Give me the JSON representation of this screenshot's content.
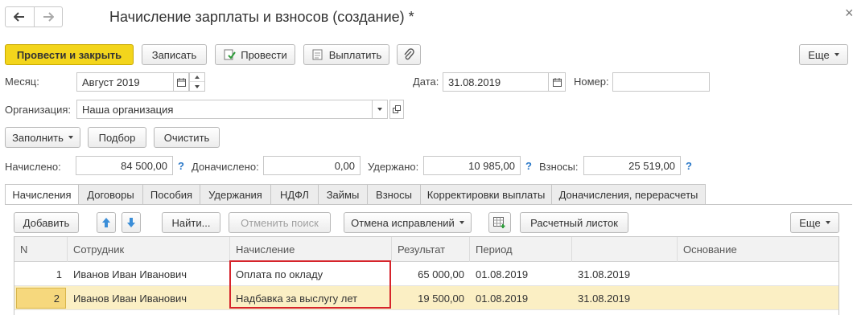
{
  "window": {
    "title": "Начисление зарплаты и взносов (создание) *",
    "close_glyph": "×"
  },
  "toolbar": {
    "post_and_close": "Провести и закрыть",
    "save": "Записать",
    "post": "Провести",
    "pay": "Выплатить",
    "more": "Еще"
  },
  "header": {
    "month_label": "Месяц:",
    "month_value": "Август 2019",
    "date_label": "Дата:",
    "date_value": "31.08.2019",
    "number_label": "Номер:",
    "number_value": "",
    "org_label": "Организация:",
    "org_value": "Наша организация"
  },
  "actions": {
    "fill": "Заполнить",
    "select": "Подбор",
    "clear": "Очистить"
  },
  "totals": {
    "accrued_label": "Начислено:",
    "accrued_value": "84 500,00",
    "additional_label": "Доначислено:",
    "additional_value": "0,00",
    "withheld_label": "Удержано:",
    "withheld_value": "10 985,00",
    "contributions_label": "Взносы:",
    "contributions_value": "25 519,00",
    "help_glyph": "?"
  },
  "tabs": [
    {
      "label": "Начисления",
      "active": true
    },
    {
      "label": "Договоры"
    },
    {
      "label": "Пособия"
    },
    {
      "label": "Удержания"
    },
    {
      "label": "НДФЛ"
    },
    {
      "label": "Займы"
    },
    {
      "label": "Взносы"
    },
    {
      "label": "Корректировки выплаты"
    },
    {
      "label": "Доначисления, перерасчеты"
    }
  ],
  "grid_toolbar": {
    "add": "Добавить",
    "find": "Найти...",
    "cancel_search": "Отменить поиск",
    "cancel_corrections": "Отмена исправлений",
    "payslip": "Расчетный листок",
    "more": "Еще"
  },
  "grid": {
    "columns": [
      "N",
      "Сотрудник",
      "Начисление",
      "Результат",
      "Период",
      "",
      "Основание"
    ],
    "rows": [
      {
        "n": "1",
        "employee": "Иванов Иван Иванович",
        "accrual": "Оплата по окладу",
        "result": "65 000,00",
        "from": "01.08.2019",
        "to": "31.08.2019",
        "basis": ""
      },
      {
        "n": "2",
        "employee": "Иванов Иван Иванович",
        "accrual": "Надбавка за выслугу лет",
        "result": "19 500,00",
        "from": "01.08.2019",
        "to": "31.08.2019",
        "basis": ""
      }
    ]
  },
  "colors": {
    "primary_button": "#f3d51c",
    "selected_row": "#fbefc4",
    "highlight_border": "#d6242b",
    "help": "#2a78c8"
  }
}
